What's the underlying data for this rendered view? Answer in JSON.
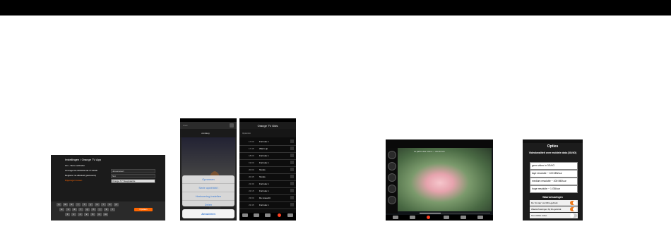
{
  "shot1": {
    "title": "Instellingen / Orange TV App",
    "rows": [
      {
        "label": "Om - Stero verbinder",
        "value": ""
      },
      {
        "label": "Omzage Kle 00:0031:CE:77:00:08",
        "value": "Jeroenweert"
      },
      {
        "label": "Registrer na afloskoll (paswoord)",
        "value": "Nut"
      },
      {
        "label": "Rijsjoingen tussen",
        "value": "Orange TV Steepkaartte"
      }
    ],
    "keys_row1": [
      "q",
      "w",
      "e",
      "r",
      "t",
      "y",
      "u",
      "i",
      "o",
      "p"
    ],
    "keys_row2": [
      "a",
      "s",
      "d",
      "f",
      "g",
      "h",
      "j",
      "k",
      "l"
    ],
    "keys_row3": [
      "z",
      "x",
      "c",
      "v",
      "b",
      "n",
      "m"
    ],
    "action_key": "Opslaan"
  },
  "shot2": {
    "search_placeholder": "Zoek",
    "nav_label": "vandaag",
    "menu_options": [
      "Opnemen",
      "Serie opnemen",
      "Herinnering instellen",
      "Delen"
    ],
    "cancel_label": "Annuleren"
  },
  "shot3": {
    "header": "Orange TV Gids",
    "sub": "Upcomin",
    "items": [
      {
        "time": "17:00",
        "program": "Formule 1"
      },
      {
        "time": "17:45",
        "program": "Warm-up"
      },
      {
        "time": "18:00",
        "program": "Formule 1"
      },
      {
        "time": "19:00",
        "program": "Formule 1"
      },
      {
        "time": "20:00",
        "program": "Tennis"
      },
      {
        "time": "20:45",
        "program": "Tennis"
      },
      {
        "time": "21:30",
        "program": "Formule 1"
      },
      {
        "time": "22:15",
        "program": "Formule 1"
      },
      {
        "time": "23:00",
        "program": "De sneuwtit"
      },
      {
        "time": "23:45",
        "program": "Formule 1"
      },
      {
        "time": "00:30",
        "program": "Tennis"
      }
    ],
    "tabs": [
      "TV",
      "Gids",
      "Opnames",
      "Live",
      "Meer"
    ]
  },
  "shot4": {
    "caption": "Le jardin des roses — via de tuin",
    "progress": 0.3,
    "channels": [
      "1",
      "2",
      "3",
      "4",
      "5",
      "6"
    ]
  },
  "shot5": {
    "title": "Opties",
    "section1": "Videokwaliteit over mobiele data (3G/4G)",
    "options": [
      "geen video in 3G/4G",
      "laye resolutie ~ 100 MB/uur",
      "medium resolutie ~ 400 MB/uur",
      "hoge resolutie ~ 1 GB/uur"
    ],
    "section2": "Waarschuwingen",
    "toggles": [
      {
        "label": "De 'Air-tap' via 3/4G-gebruik",
        "on": true
      },
      {
        "label": "Waarschuwingen bij 3G-gebruik",
        "on": true
      },
      {
        "label": "Toon biblio video",
        "on": false
      }
    ],
    "accent": "#f07a1a"
  },
  "colors": {
    "topbar": "#000000",
    "accent": "#ff6600"
  }
}
